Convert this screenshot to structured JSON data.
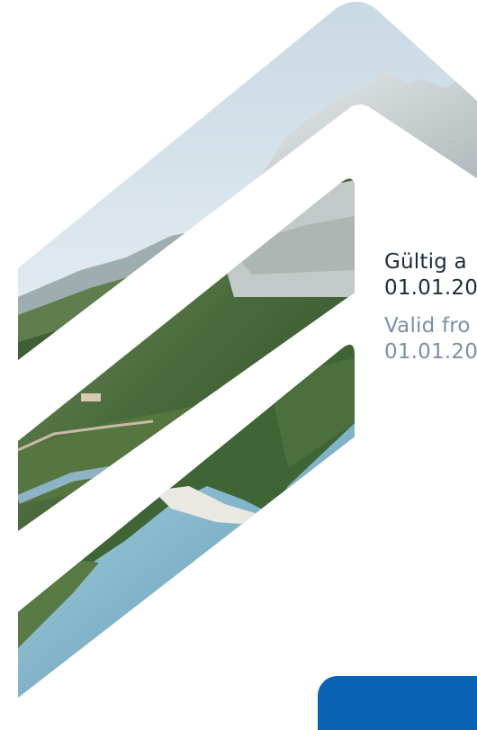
{
  "validity": {
    "german_label": "Gültig a",
    "german_date": "01.01.20",
    "english_label": "Valid fro",
    "english_date": "01.01.20"
  },
  "colors": {
    "german_text": "#1b2c40",
    "english_text": "#7b90a8",
    "bottom_tab": "#0a62b5",
    "sky": "#dde8ef",
    "mountain": "#cdd6da",
    "forest": "#4f7040",
    "river": "#7bb0c8"
  },
  "imagery": {
    "icon": "landscape-chevron-graphic"
  }
}
